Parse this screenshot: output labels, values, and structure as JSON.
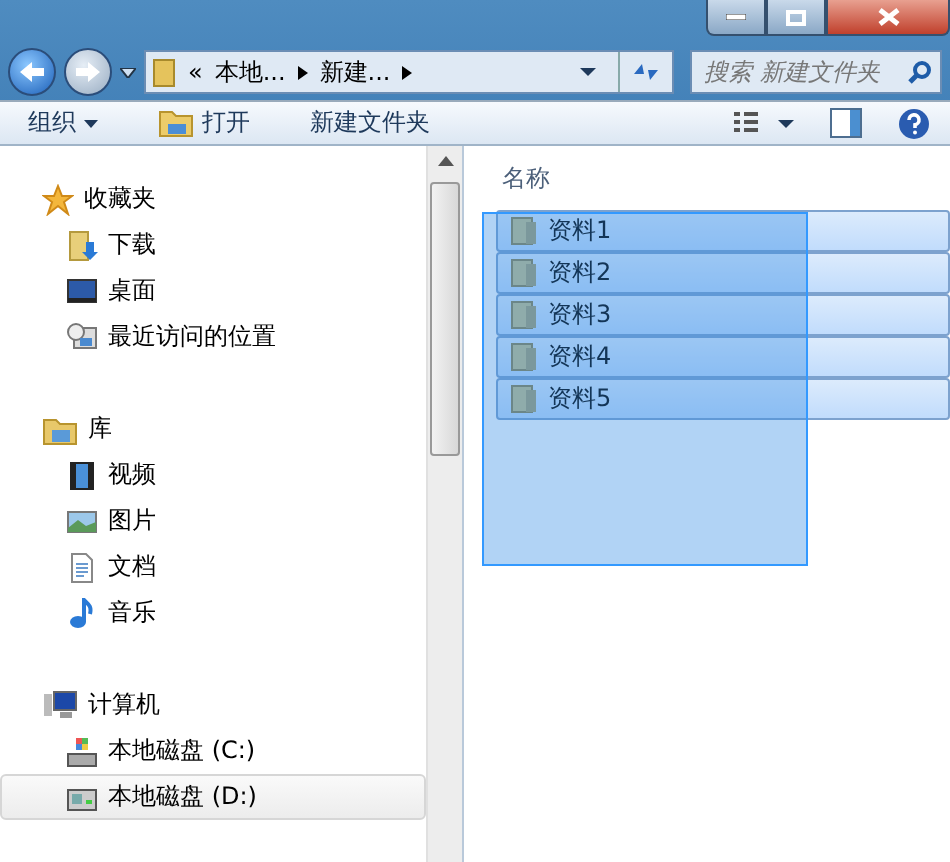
{
  "address_bar": {
    "overflow": "«",
    "segments": [
      "本地...",
      "新建..."
    ]
  },
  "search": {
    "placeholder": "搜索 新建文件夹"
  },
  "toolbar": {
    "items": [
      {
        "label": "组织",
        "kind": "menu"
      },
      {
        "label": "打开",
        "kind": "open"
      },
      {
        "label": "新建文件夹",
        "kind": "plain"
      }
    ]
  },
  "nav_pane": {
    "groups": [
      {
        "label": "收藏夹",
        "children": [
          {
            "label": "下载",
            "selected": false
          },
          {
            "label": "桌面",
            "selected": false
          },
          {
            "label": "最近访问的位置",
            "selected": false
          }
        ]
      },
      {
        "label": "库",
        "children": [
          {
            "label": "视频",
            "selected": false
          },
          {
            "label": "图片",
            "selected": false
          },
          {
            "label": "文档",
            "selected": false
          },
          {
            "label": "音乐",
            "selected": false
          }
        ]
      },
      {
        "label": "计算机",
        "children": [
          {
            "label": "本地磁盘 (C:)",
            "selected": false
          },
          {
            "label": "本地磁盘 (D:)",
            "selected": true
          }
        ]
      }
    ]
  },
  "file_list": {
    "columns": [
      "名称"
    ],
    "rows": [
      {
        "name": "资料1",
        "selected": true
      },
      {
        "name": "资料2",
        "selected": true
      },
      {
        "name": "资料3",
        "selected": true
      },
      {
        "name": "资料4",
        "selected": true
      },
      {
        "name": "资料5",
        "selected": true
      }
    ]
  }
}
